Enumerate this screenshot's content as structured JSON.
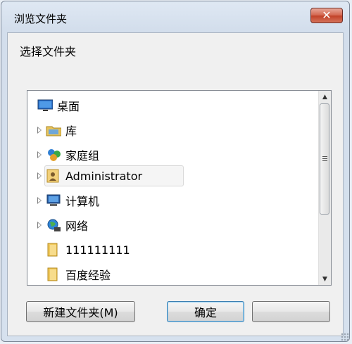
{
  "window": {
    "title": "浏览文件夹",
    "close_symbol": "✕"
  },
  "prompt": "选择文件夹",
  "tree": {
    "items": [
      {
        "label": "桌面",
        "icon": "desktop-icon",
        "expandable": false
      },
      {
        "label": "库",
        "icon": "library-icon",
        "expandable": true
      },
      {
        "label": "家庭组",
        "icon": "homegroup-icon",
        "expandable": true
      },
      {
        "label": "Administrator",
        "icon": "user-folder-icon",
        "expandable": true,
        "selected": true
      },
      {
        "label": "计算机",
        "icon": "computer-icon",
        "expandable": true
      },
      {
        "label": "网络",
        "icon": "network-icon",
        "expandable": true
      },
      {
        "label": "111111111",
        "icon": "folder-icon",
        "expandable": false
      },
      {
        "label": "百度经验",
        "icon": "folder-icon",
        "expandable": false
      }
    ]
  },
  "scrollbar": {
    "up_symbol": "▲",
    "down_symbol": "▼"
  },
  "buttons": {
    "new_folder": "新建文件夹(M)",
    "ok": "确定",
    "cancel": ""
  },
  "colors": {
    "title_bar": "#dfe8f3",
    "close_button": "#c2432a",
    "primary_border": "#3c7fb1"
  }
}
